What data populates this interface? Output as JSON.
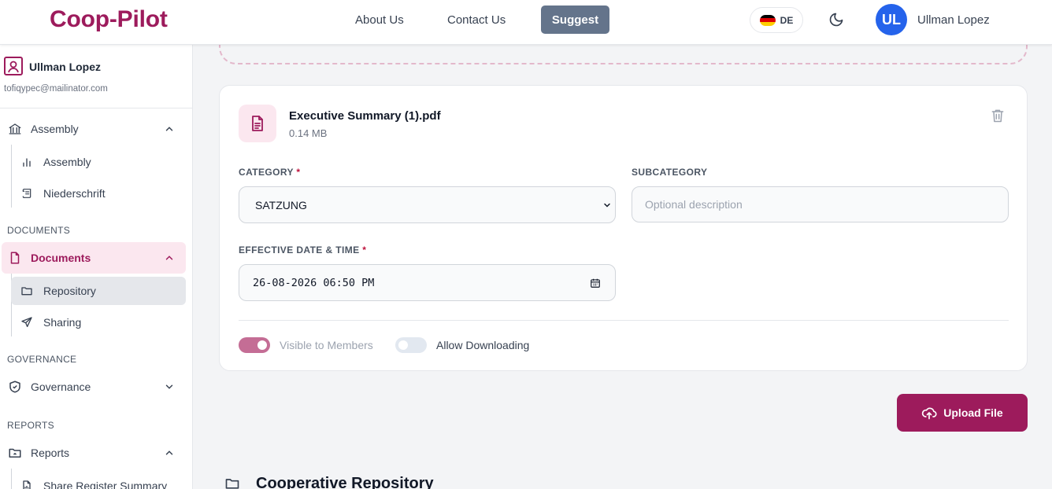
{
  "header": {
    "brand": "Coop-Pilot",
    "nav": {
      "about": "About Us",
      "contact": "Contact Us",
      "suggest": "Suggest"
    },
    "language": "DE",
    "avatar_initials": "UL",
    "user_name": "Ullman Lopez"
  },
  "sidebar": {
    "user_name": "Ullman Lopez",
    "user_email": "tofiqypec@mailinator.com",
    "assembly": {
      "label": "Assembly",
      "subs": [
        "Assembly",
        "Niederschrift"
      ]
    },
    "documents_section": "DOCUMENTS",
    "documents": {
      "label": "Documents",
      "subs": [
        "Repository",
        "Sharing"
      ]
    },
    "governance_section": "GOVERNANCE",
    "governance": {
      "label": "Governance"
    },
    "reports_section": "REPORTS",
    "reports": {
      "label": "Reports",
      "subs": [
        "Share Register Summary"
      ]
    }
  },
  "file": {
    "name": "Executive Summary (1).pdf",
    "size": "0.14 MB"
  },
  "form": {
    "category_label": "CATEGORY",
    "category_value": "SATZUNG",
    "subcategory_label": "SUBCATEGORY",
    "subcategory_placeholder": "Optional description",
    "date_label": "EFFECTIVE DATE & TIME",
    "date_value": "26-08-2026 06:50 PM",
    "required_mark": "*",
    "visible_label": "Visible to Members",
    "visible_on": true,
    "download_label": "Allow Downloading",
    "download_on": false
  },
  "actions": {
    "upload": "Upload File"
  },
  "repository": {
    "title": "Cooperative Repository"
  },
  "colors": {
    "brand": "#9d1b5c",
    "suggest": "#64748b",
    "avatar": "#2563eb",
    "toggle_on": "#c46d95"
  }
}
